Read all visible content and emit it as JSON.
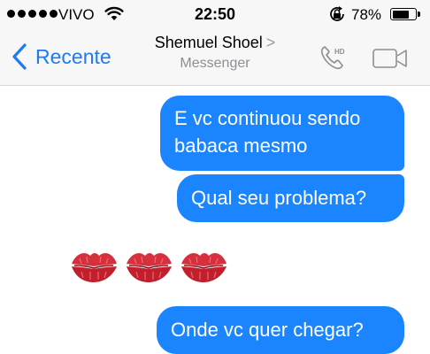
{
  "status_bar": {
    "carrier": "VIVO",
    "time": "22:50",
    "battery": "78%",
    "battery_level": 0.78,
    "icons": [
      "signal-dots",
      "wifi-icon",
      "orientation-lock-icon",
      "battery-icon"
    ]
  },
  "nav": {
    "back_label": "Recente",
    "contact_name": "Shemuel Shoel",
    "subtitle": "Messenger",
    "name_chevron": ">",
    "call_badge": "HD",
    "icons": [
      "back-chevron-icon",
      "phone-hd-icon",
      "video-camera-icon"
    ],
    "accent_color": "#1e7bf1"
  },
  "messages": [
    {
      "sender": "me",
      "text": "E vc continuou sendo babaca mesmo"
    },
    {
      "sender": "me",
      "text": "Qual seu problema?"
    },
    {
      "sender": "other",
      "type": "emoji",
      "emoji": "💋💋💋",
      "count": 3
    },
    {
      "sender": "me",
      "text": "Onde vc quer chegar?"
    }
  ],
  "colors": {
    "bubble_me": "#1b84ff",
    "bubble_text": "#ffffff",
    "bar_background": "#f7f7f7"
  }
}
